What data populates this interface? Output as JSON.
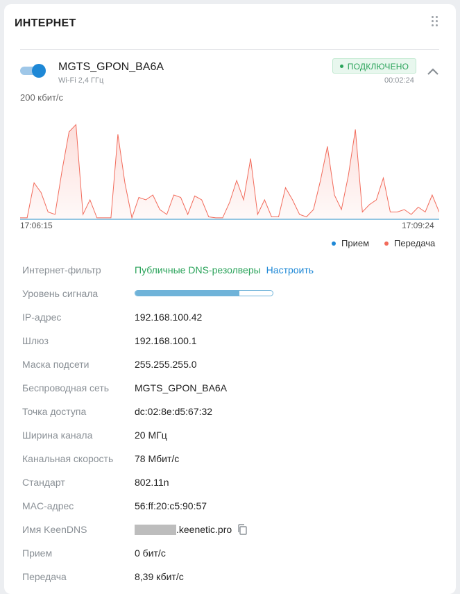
{
  "card": {
    "title": "ИНТЕРНЕТ"
  },
  "connection": {
    "name": "MGTS_GPON_BA6A",
    "subtitle": "Wi-Fi 2,4 ГГц",
    "status": "ПОДКЛЮЧЕНО",
    "uptime": "00:02:24",
    "enabled": true
  },
  "chart_data": {
    "type": "area",
    "ymax_label": "200 кбит/с",
    "ylim": [
      0,
      200
    ],
    "x_start_label": "17:06:15",
    "x_end_label": "17:09:24",
    "legend": [
      "Прием",
      "Передача"
    ],
    "legend_placement": "bottom-right",
    "series": [
      {
        "name": "Прием",
        "color": "#1e88d6",
        "values": [
          0,
          0,
          0,
          0,
          0,
          0,
          0,
          0,
          0,
          0,
          0,
          0,
          0,
          0,
          0,
          0,
          0,
          0,
          0,
          0,
          0,
          0,
          0,
          0,
          0,
          0,
          0,
          0,
          0,
          0,
          0,
          0,
          0,
          0,
          0,
          0,
          0,
          0,
          0,
          0,
          0,
          0,
          0,
          0,
          0,
          0,
          0,
          0,
          0,
          0,
          0,
          0,
          0,
          0,
          0,
          0,
          0,
          0,
          0,
          0,
          0
        ]
      },
      {
        "name": "Передача",
        "color": "#f26b5b",
        "values": [
          3,
          3,
          75,
          55,
          15,
          10,
          100,
          180,
          195,
          10,
          40,
          3,
          3,
          3,
          175,
          75,
          3,
          45,
          40,
          50,
          20,
          10,
          50,
          45,
          10,
          48,
          40,
          5,
          3,
          3,
          35,
          80,
          40,
          125,
          10,
          40,
          5,
          5,
          65,
          40,
          10,
          5,
          20,
          80,
          150,
          50,
          20,
          90,
          185,
          15,
          30,
          40,
          85,
          15,
          15,
          20,
          10,
          25,
          15,
          50,
          15
        ]
      }
    ]
  },
  "details": {
    "filter_label": "Интернет-фильтр",
    "filter_value": "Публичные DNS-резолверы",
    "filter_action": "Настроить",
    "signal_label": "Уровень сигнала",
    "signal_level": 0.76,
    "ip_label": "IP-адрес",
    "ip_value": "192.168.100.42",
    "gateway_label": "Шлюз",
    "gateway_value": "192.168.100.1",
    "mask_label": "Маска подсети",
    "mask_value": "255.255.255.0",
    "wireless_label": "Беспроводная сеть",
    "wireless_value": "MGTS_GPON_BA6A",
    "ap_label": "Точка доступа",
    "ap_value": "dc:02:8e:d5:67:32",
    "width_label": "Ширина канала",
    "width_value": "20 МГц",
    "rate_label": "Канальная скорость",
    "rate_value": "78 Мбит/с",
    "standard_label": "Стандарт",
    "standard_value": "802.11n",
    "mac_label": "MAC-адрес",
    "mac_value": "56:ff:20:c5:90:57",
    "keendns_label": "Имя KeenDNS",
    "keendns_suffix": ".keenetic.pro",
    "rx_label": "Прием",
    "rx_value": "0 бит/с",
    "tx_label": "Передача",
    "tx_value": "8,39 кбит/с"
  },
  "icons": {
    "drag": "drag-handle-icon",
    "collapse": "chevron-up-icon",
    "copy": "copy-icon"
  }
}
